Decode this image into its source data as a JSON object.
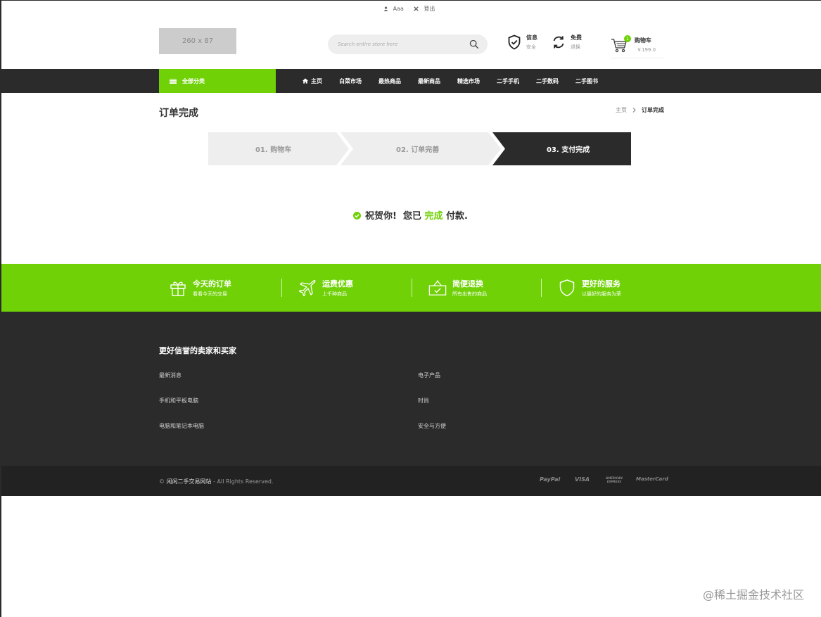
{
  "topbar": {
    "user": "Aaa",
    "logout": "登出"
  },
  "header": {
    "logo": "260 x 87",
    "search_placeholder": "Search entire store here",
    "features": [
      {
        "title": "信息",
        "sub": "安全"
      },
      {
        "title": "免费",
        "sub": "退换"
      }
    ],
    "cart": {
      "label": "购物车",
      "count": "1",
      "price": "￥199.0"
    }
  },
  "nav": {
    "category": "全部分类",
    "items": [
      "主页",
      "白菜市场",
      "最热商品",
      "最新商品",
      "精选市场",
      "二手手机",
      "二手数码",
      "二手图书"
    ]
  },
  "page": {
    "title": "订单完成",
    "breadcrumb": {
      "home": "主页",
      "current": "订单完成"
    }
  },
  "steps": [
    "01. 购物车",
    "02. 订单完善",
    "03. 支付完成"
  ],
  "success": {
    "prefix": "祝贺你!  您已 ",
    "highlight": "完成",
    "suffix": " 付款."
  },
  "band": [
    {
      "title": "今天的订单",
      "sub": "看看今天的交易"
    },
    {
      "title": "运费优惠",
      "sub": "上千种商品"
    },
    {
      "title": "简便退换",
      "sub": "所有出售的商品"
    },
    {
      "title": "更好的服务",
      "sub": "以最好的服务为荣"
    }
  ],
  "footer": {
    "title": "更好信誉的卖家和买家",
    "links_left": [
      "最新消息",
      "手机和平板电脑",
      "电脑和笔记本电脑"
    ],
    "links_right": [
      "电子产品",
      "时尚",
      "安全与方便"
    ],
    "copyright_prefix": "© ",
    "copyright_name": "闲闲二手交易网站",
    "copyright_suffix": " - All Rights Reserved.",
    "payments": [
      "PayPal",
      "VISA",
      "AMERICAN EXPRESS",
      "MasterCard"
    ]
  },
  "watermark": "@稀土掘金技术社区",
  "colors": {
    "accent": "#6fd106",
    "dark": "#2b2b2b",
    "darker": "#222222"
  }
}
